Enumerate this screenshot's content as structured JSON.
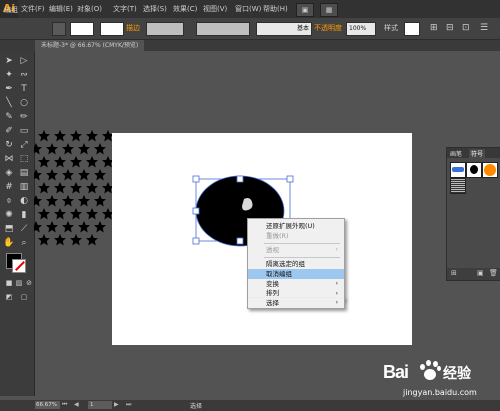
{
  "app": {
    "logo": "Ai"
  },
  "menubar": {
    "items": [
      "文件(F)",
      "编辑(E)",
      "对象(O)",
      "文字(T)",
      "选择(S)",
      "效果(C)",
      "视图(V)",
      "窗口(W)",
      "帮助(H)"
    ]
  },
  "controlbar": {
    "selection_label": "编组",
    "stroke_label": "描边",
    "brush_label": "基本",
    "opacity_label": "不透明度",
    "opacity_value": "100%",
    "style_label": "样式"
  },
  "document_tab": {
    "title": "未标题-3* @ 66.67% (CMYK/预览)"
  },
  "panel": {
    "tabs": [
      "画笔",
      "符号"
    ]
  },
  "context_menu": {
    "items": [
      {
        "label": "还原扩展外观(U)",
        "disabled": false,
        "submenu": false,
        "highlighted": false
      },
      {
        "label": "重做(R)",
        "disabled": true,
        "submenu": false,
        "highlighted": false
      },
      {
        "label": "透视",
        "disabled": true,
        "submenu": true,
        "highlighted": false
      },
      {
        "label": "隔离选定的组",
        "disabled": false,
        "submenu": false,
        "highlighted": false
      },
      {
        "label": "取消编组",
        "disabled": false,
        "submenu": false,
        "highlighted": true
      },
      {
        "label": "变换",
        "disabled": false,
        "submenu": true,
        "highlighted": false
      },
      {
        "label": "排列",
        "disabled": false,
        "submenu": true,
        "highlighted": false
      },
      {
        "label": "选择",
        "disabled": false,
        "submenu": true,
        "highlighted": false
      }
    ]
  },
  "statusbar": {
    "zoom": "66.67%",
    "page": "1",
    "tool": "选择"
  },
  "watermark": {
    "brand": "Bai",
    "brand2": "经验",
    "url": "jingyan.baidu.com"
  },
  "colors": {
    "accent_orange": "#ff9a00",
    "highlight": "#9cc8f0",
    "brand_blue": "#2a5fbf",
    "brand_red": "#d81e06"
  }
}
